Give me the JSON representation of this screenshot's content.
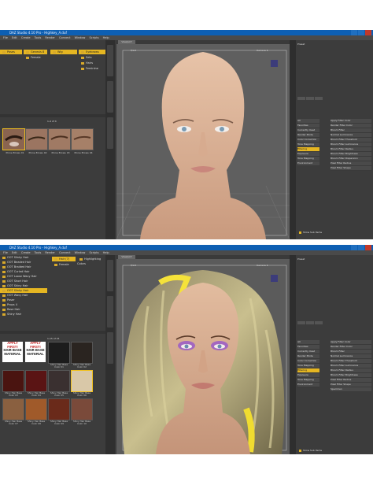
{
  "shots": [
    {
      "title": "DAZ Studio 4.10 Pro - Highkey_A.duf",
      "menu": [
        "File",
        "Edit",
        "Create",
        "Tools",
        "Render",
        "Connect",
        "Window",
        "Scripts",
        "Help"
      ],
      "left_header": [
        "Poses",
        "Genesis 8",
        "Wig"
      ],
      "left_header_right": "Eyebrows",
      "left_sub": [
        "Female",
        "Sets",
        "Hairs",
        "Feminine"
      ],
      "pager": "1-4 of 4",
      "thumbs": [
        "Pinne Brows 01",
        "Pinne Brows 02",
        "Pinne Brows 03",
        "Pinne Brows 04"
      ],
      "viewport_tab": "Viewport",
      "viewport_camera": "Camera 1",
      "right_items": [
        "All",
        "Favorites",
        "Currently Used",
        "Render Mode",
        "Color Correction",
        "Tone Mapping",
        "Filtering",
        "Exposure Adjustment",
        "Tone Mapping",
        "Environment"
      ],
      "right_highlight": "Filtering",
      "props": [
        "Apply Filter Color",
        "Render Filter Color",
        "Bloom Filter",
        "Normal Luminance",
        "Bloom Filter Threshold",
        "Bloom Filter Luminance",
        "Bloom Filter Radius",
        "Bloom Filter Brightness",
        "Bloom Filter Dispersion",
        "Pixel Filter Radius",
        "Pixel Filter Shape"
      ],
      "footer_checkbox": "Show Sub Items"
    },
    {
      "title": "DAZ Studio 4.10 Pro - Highkey_A.duf",
      "menu": [
        "File",
        "Edit",
        "Create",
        "Tools",
        "Render",
        "Connect",
        "Window",
        "Scripts",
        "Help"
      ],
      "left_tree": [
        "OOT Slinky Hair",
        "OOT Beaded Hair",
        "OOT Braided Hair",
        "OOT Curled Hair",
        "OOT Loose Wavy Hair",
        "OOT Short Hair",
        "OOT Shiny Hair",
        "OOT Slinky Hair",
        "OOT Wavy Hair",
        "Poser",
        "Props 4",
        "Rose Hair",
        "Shiny Hair"
      ],
      "left_tree_highlight": "OOT Slinky Hair",
      "left_header_mid": "Hair (7)",
      "left_header_right": "Highlighting Colors",
      "left_sub": [
        "Female",
        "Sets",
        "Hairs",
        "Feminine"
      ],
      "pager": "1-15 of 15",
      "promo_line1": "APPLY",
      "promo_line2": "FIRST!",
      "promo_line3": "HAIR BASE",
      "promo_line4": "MATERIAL",
      "promo_caption": "Shiny Hair Base",
      "hair_thumbs": [
        "Shiny Hair Base Color 01",
        "Shiny Hair Base Color 02",
        "Shiny Hair Base Color 03",
        "Shiny Hair Base Color 04",
        "Shiny Hair Base Color 05",
        "Shiny Hair Base Color 06",
        "Shiny Hair Base Color 07",
        "Shiny Hair Base Color 08",
        "Shiny Hair Base Color 09",
        "Shiny Hair Base Color 10"
      ],
      "viewport_tab": "Viewport",
      "viewport_camera": "Camera 1",
      "right_items": [
        "All",
        "Favorites",
        "Currently Used",
        "Render Mode",
        "Color Correction",
        "Tone Mapping",
        "Filtering",
        "Exposure Adjustment",
        "Tone Mapping",
        "Environment"
      ],
      "right_highlight": "Filtering",
      "props": [
        "Apply Filter Color",
        "Render Filter Color",
        "Bloom Filter",
        "Normal Luminance",
        "Bloom Filter Threshold",
        "Bloom Filter Luminance",
        "Bloom Filter Radius",
        "Bloom Filter Brightness",
        "Pixel Filter Radius",
        "Pixel Filter Shape",
        "Specimen"
      ],
      "footer_checkbox": "Show Sub Items"
    }
  ],
  "colors": {
    "accent": "#e5b622",
    "titlebar": "#0d5fb3",
    "panel": "#3c3c3c",
    "viewport": "#595959"
  }
}
